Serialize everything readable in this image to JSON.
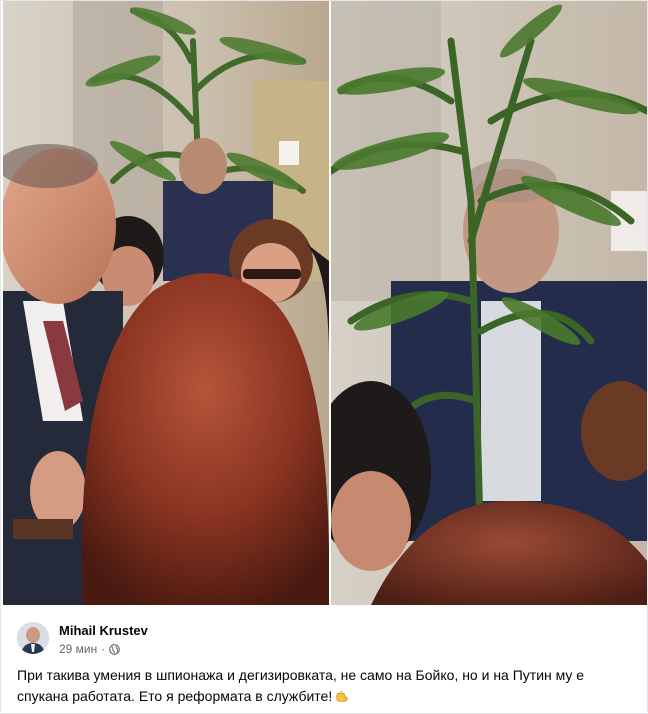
{
  "post": {
    "author": "Mihail Krustev",
    "time": "29 мин",
    "separator": "·",
    "audience_icon": "globe-icon",
    "text": "При такива умения в шпионажа и дегизировката, не само на Бойко, но и на Путин му е спукана работата. Ето я реформата в службите!",
    "emoji_icon": "thumbs-up-hand-emoji"
  },
  "colors": {
    "author_text": "#050505",
    "meta_text": "#65676b"
  }
}
